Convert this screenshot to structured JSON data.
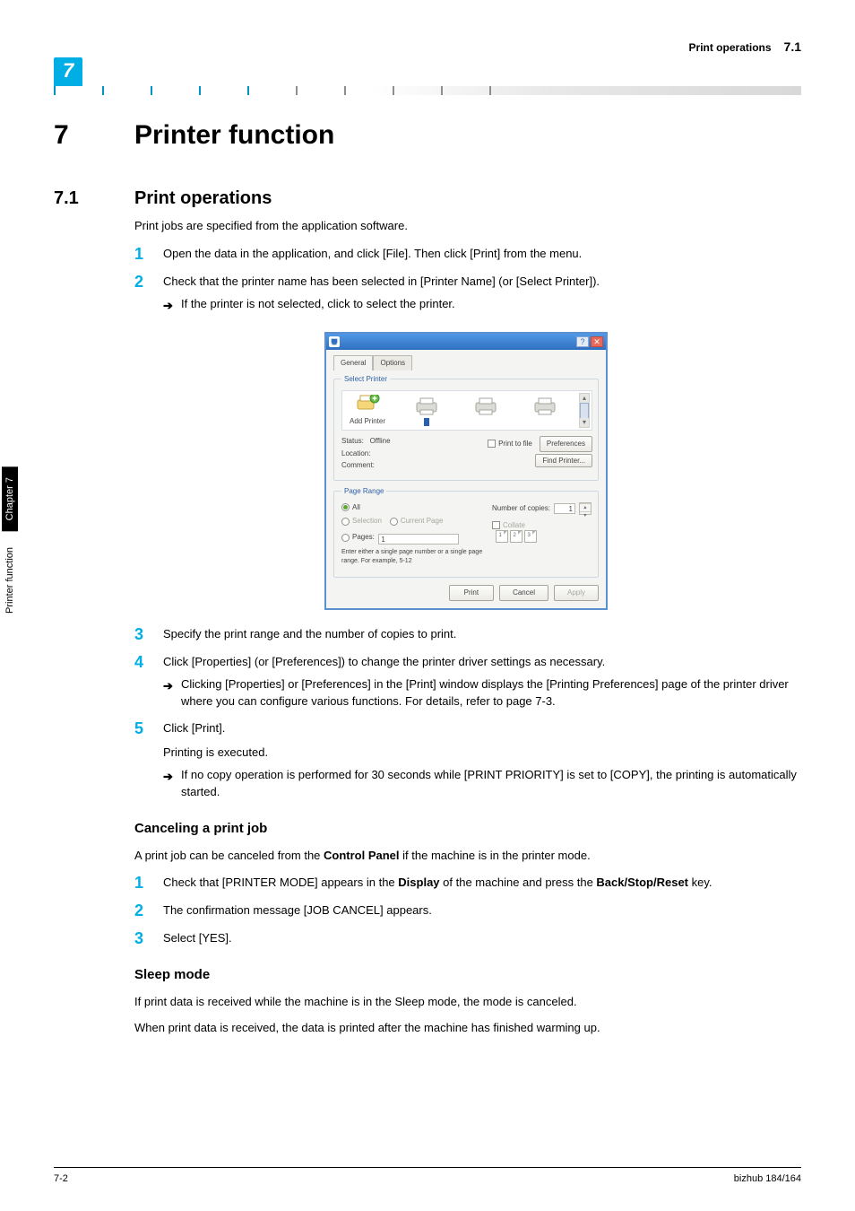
{
  "header": {
    "section_title": "Print operations",
    "section_num": "7.1",
    "chapter_badge": "7"
  },
  "h1": {
    "num": "7",
    "title": "Printer function"
  },
  "h2": {
    "num": "7.1",
    "title": "Print operations"
  },
  "intro": "Print jobs are specified from the application software.",
  "steps_a": {
    "1": "Open the data in the application, and click [File]. Then click [Print] from the menu.",
    "2": {
      "text": "Check that the printer name has been selected in [Printer Name] (or [Select Printer]).",
      "sub": "If the printer is not selected, click to select the printer."
    },
    "3": "Specify the print range and the number of copies to print.",
    "4": {
      "text": "Click [Properties] (or [Preferences]) to change the printer driver settings as necessary.",
      "sub": "Clicking [Properties] or [Preferences] in the [Print] window displays the [Printing Preferences] page of the printer driver where you can configure various functions. For details, refer to page 7-3."
    },
    "5": {
      "text": "Click [Print].",
      "line2": "Printing is executed.",
      "sub": "If no copy operation is performed for 30 seconds while [PRINT PRIORITY] is set to [COPY], the printing is automatically started."
    }
  },
  "dialog": {
    "tabs": {
      "general": "General",
      "options": "Options"
    },
    "select_printer": "Select Printer",
    "add_printer": "Add Printer",
    "status_lbl": "Status:",
    "status_val": "Offline",
    "location": "Location:",
    "comment": "Comment:",
    "print_to_file": "Print to file",
    "preferences": "Preferences",
    "find_printer": "Find Printer...",
    "page_range": "Page Range",
    "all": "All",
    "selection": "Selection",
    "current_page": "Current Page",
    "pages": "Pages:",
    "pages_val": "1",
    "pages_hint": "Enter either a single page number or a single page range.  For example, 5-12",
    "copies_lbl": "Number of copies:",
    "copies_val": "1",
    "collate": "Collate",
    "print": "Print",
    "cancel": "Cancel",
    "apply": "Apply",
    "sheet1": "1",
    "sheet2": "2",
    "sheet3": "3"
  },
  "cancel_section": {
    "title": "Canceling a print job",
    "intro_a": "A print job can be canceled from the ",
    "intro_b": "Control Panel",
    "intro_c": " if the machine is in the printer mode.",
    "s1a": "Check that [PRINTER MODE] appears in the ",
    "s1b": "Display",
    "s1c": " of the machine and press the ",
    "s1d": "Back/Stop/Reset",
    "s1e": " key.",
    "s2": "The confirmation message [JOB CANCEL] appears.",
    "s3": "Select [YES]."
  },
  "sleep_section": {
    "title": "Sleep mode",
    "p1": "If print data is received while the machine is in the Sleep mode, the mode is canceled.",
    "p2": "When print data is received, the data is printed after the machine has finished warming up."
  },
  "sidetab": {
    "chapter": "Chapter 7",
    "label": "Printer function"
  },
  "footer": {
    "page": "7-2",
    "product": "bizhub 184/164"
  }
}
